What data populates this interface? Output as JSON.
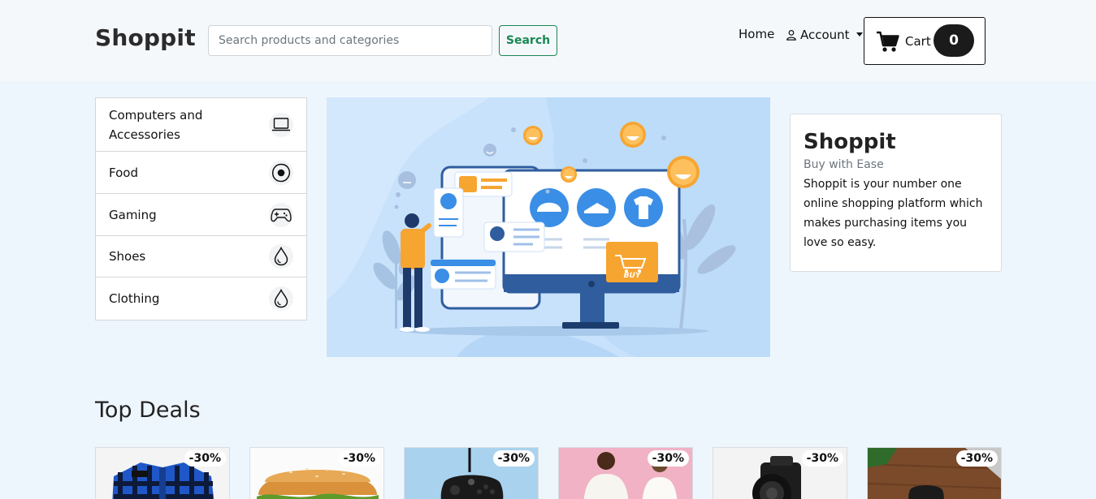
{
  "header": {
    "brand": "Shoppit",
    "search_placeholder": "Search products and categories",
    "search_button": "Search",
    "nav_home": "Home",
    "nav_account": "Account",
    "cart_label": "Cart",
    "cart_count": "0"
  },
  "categories": [
    {
      "label": "Computers and Accessories",
      "icon": "laptop-icon"
    },
    {
      "label": "Food",
      "icon": "food-icon"
    },
    {
      "label": "Gaming",
      "icon": "gamepad-icon"
    },
    {
      "label": "Shoes",
      "icon": "drop-icon"
    },
    {
      "label": "Clothing",
      "icon": "drop-icon"
    }
  ],
  "hero": {
    "buy_tag": "BUY"
  },
  "info_card": {
    "title": "Shoppit",
    "subtitle": "Buy with Ease",
    "text": "Shoppit is your number one online shopping platform which makes purchasing items you love so easy."
  },
  "deals": {
    "title": "Top Deals",
    "items": [
      {
        "badge": "-30%",
        "subject": "shirt"
      },
      {
        "badge": "-30%",
        "subject": "burger"
      },
      {
        "badge": "-30%",
        "subject": "controller"
      },
      {
        "badge": "-30%",
        "subject": "people"
      },
      {
        "badge": "-30%",
        "subject": "camera"
      },
      {
        "badge": "-30%",
        "subject": "desk"
      }
    ]
  },
  "colors": {
    "accent_green": "#198754",
    "page_bg": "#eef6fd",
    "hero_bg": "#c8e2fb",
    "smiley": "#f7a531"
  }
}
